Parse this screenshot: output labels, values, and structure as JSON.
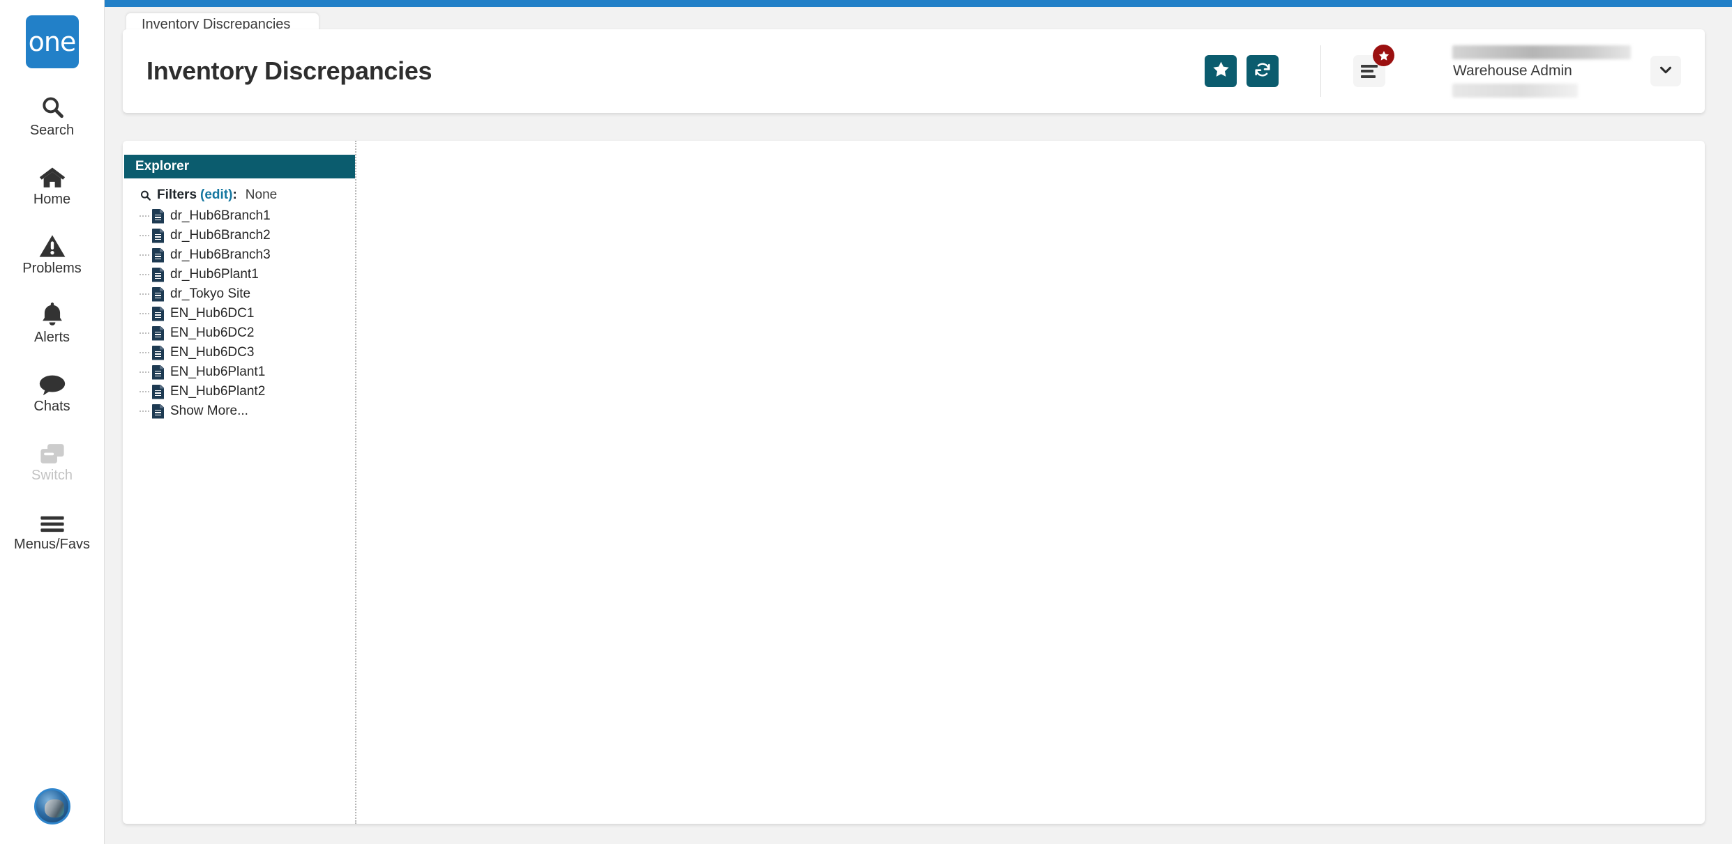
{
  "rail": {
    "logo_text": "one",
    "items": [
      {
        "label": "Search",
        "icon": "search-icon",
        "disabled": false
      },
      {
        "label": "Home",
        "icon": "home-icon",
        "disabled": false
      },
      {
        "label": "Problems",
        "icon": "warning-triangle-icon",
        "disabled": false
      },
      {
        "label": "Alerts",
        "icon": "bell-icon",
        "disabled": false
      },
      {
        "label": "Chats",
        "icon": "chat-bubble-icon",
        "disabled": false
      },
      {
        "label": "Switch",
        "icon": "switch-windows-icon",
        "disabled": true
      },
      {
        "label": "Menus/Favs",
        "icon": "hamburger-icon",
        "disabled": false
      }
    ],
    "avatar_name": "user-avatar"
  },
  "tabs": [
    {
      "label": "Inventory Discrepancies",
      "active": true
    }
  ],
  "header": {
    "title": "Inventory Discrepancies",
    "buttons": [
      {
        "name": "favorite-button",
        "icon": "star-icon"
      },
      {
        "name": "refresh-button",
        "icon": "refresh-icon"
      }
    ],
    "menu_button": {
      "name": "menus-favorites-button",
      "icon": "hamburger-icon",
      "badge_icon": "star-icon"
    },
    "user": {
      "name": "Warehouse Admin",
      "caret_icon": "chevron-down-icon"
    }
  },
  "explorer": {
    "title": "Explorer",
    "filters": {
      "icon": "search-icon",
      "label": "Filters",
      "edit_label": "(edit)",
      "colon": ":",
      "value": "None"
    },
    "items": [
      {
        "label": "dr_Hub6Branch1"
      },
      {
        "label": "dr_Hub6Branch2"
      },
      {
        "label": "dr_Hub6Branch3"
      },
      {
        "label": "dr_Hub6Plant1"
      },
      {
        "label": "dr_Tokyo Site"
      },
      {
        "label": "EN_Hub6DC1"
      },
      {
        "label": "EN_Hub6DC2"
      },
      {
        "label": "EN_Hub6DC3"
      },
      {
        "label": "EN_Hub6Plant1"
      },
      {
        "label": "EN_Hub6Plant2"
      },
      {
        "label": "Show More..."
      }
    ]
  },
  "colors": {
    "brand_blue": "#2280c8",
    "teal": "#0b5c6e",
    "badge_red": "#9b1010",
    "link_teal": "#1577a0",
    "page_bg": "#f2f2f2"
  }
}
